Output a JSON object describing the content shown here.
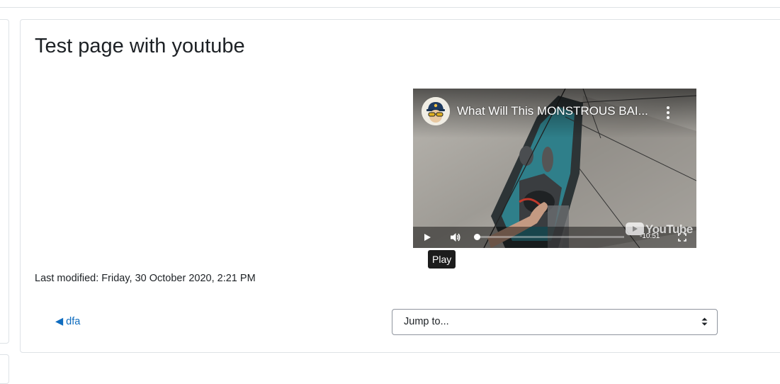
{
  "page": {
    "title": "Test page with youtube",
    "last_modified": "Last modified: Friday, 30 October 2020, 2:21 PM"
  },
  "video": {
    "title": "What Will This MONSTROUS BAI...",
    "duration": "-10:51",
    "tooltip": "Play",
    "logo_text": "YouTube",
    "played_fraction": 0
  },
  "navigation": {
    "prev_link": "◀ dfa",
    "jump_to_label": "Jump to..."
  },
  "colors": {
    "link": "#0f6cbf",
    "text": "#1d2125",
    "border": "#dee2e6"
  }
}
